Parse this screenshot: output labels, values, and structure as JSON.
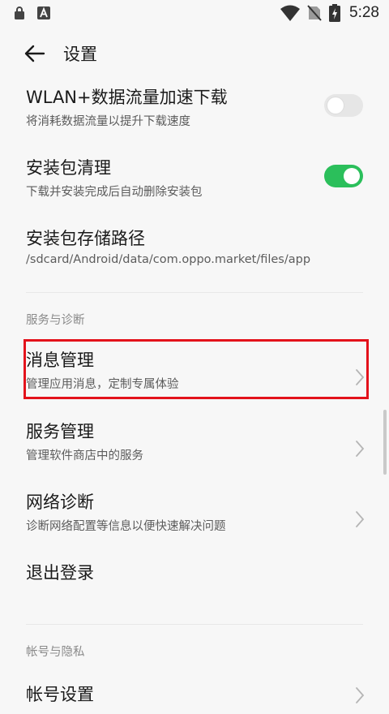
{
  "status_bar": {
    "time": "5:28",
    "icons": [
      "lock-notification-icon",
      "a-notification-icon",
      "wifi-icon",
      "no-sim-icon",
      "battery-charging-icon"
    ]
  },
  "header": {
    "back_icon": "arrow-left-icon",
    "title": "设置"
  },
  "settings": [
    {
      "title": "WLAN+数据流量加速下载",
      "subtitle": "将消耗数据流量以提升下载速度",
      "control": "toggle",
      "state": "off"
    },
    {
      "title": "安装包清理",
      "subtitle": "下载并安装完成后自动删除安装包",
      "control": "toggle",
      "state": "on"
    },
    {
      "title": "安装包存储路径",
      "subtitle": "/sdcard/Android/data/com.oppo.market/files/app"
    }
  ],
  "section_service": {
    "label": "服务与诊断",
    "items": [
      {
        "title": "消息管理",
        "subtitle": "管理应用消息，定制专属体验",
        "control": "chevron",
        "highlighted": true
      },
      {
        "title": "服务管理",
        "subtitle": "管理软件商店中的服务",
        "control": "chevron"
      },
      {
        "title": "网络诊断",
        "subtitle": "诊断网络配置等信息以便快速解决问题",
        "control": "chevron"
      },
      {
        "title": "退出登录"
      }
    ]
  },
  "section_account": {
    "label": "帐号与隐私",
    "items": [
      {
        "title": "帐号设置",
        "control": "chevron"
      }
    ]
  },
  "colors": {
    "toggle_on": "#2bbf5b",
    "toggle_off": "#e6e6e6",
    "highlight": "#e3121b",
    "background": "#f7f7f7"
  }
}
